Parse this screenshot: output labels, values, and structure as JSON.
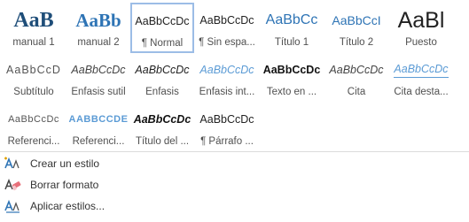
{
  "styles": [
    {
      "preview": "AaB",
      "label": "manual 1"
    },
    {
      "preview": "AaBb",
      "label": "manual 2"
    },
    {
      "preview": "AaBbCcDc",
      "label": "¶ Normal"
    },
    {
      "preview": "AaBbCcDc",
      "label": "¶ Sin espa..."
    },
    {
      "preview": "AaBbCc",
      "label": "Título 1"
    },
    {
      "preview": "AaBbCcI",
      "label": "Título 2"
    },
    {
      "preview": "AaBl",
      "label": "Puesto"
    },
    {
      "preview": "AaBbCcD",
      "label": "Subtítulo"
    },
    {
      "preview": "AaBbCcDc",
      "label": "Énfasis sutil"
    },
    {
      "preview": "AaBbCcDc",
      "label": "Énfasis"
    },
    {
      "preview": "AaBbCcDc",
      "label": "Énfasis int..."
    },
    {
      "preview": "AaBbCcDc",
      "label": "Texto en ..."
    },
    {
      "preview": "AaBbCcDc",
      "label": "Cita"
    },
    {
      "preview": "AaBbCcDc",
      "label": "Cita desta..."
    },
    {
      "preview": "AaBbCcDc",
      "label": "Referenci..."
    },
    {
      "preview": "AABBCCDE",
      "label": "Referenci..."
    },
    {
      "preview": "AaBbCcDc",
      "label": "Título del ..."
    },
    {
      "preview": "AaBbCcDc",
      "label": "¶ Párrafo ..."
    }
  ],
  "commands": [
    {
      "label": "Crear un estilo",
      "icon": "create-style-icon"
    },
    {
      "label": "Borrar formato",
      "icon": "clear-formatting-icon"
    },
    {
      "label": "Aplicar estilos...",
      "icon": "apply-styles-icon"
    }
  ],
  "colors": {
    "heading_blue": "#2e74b5",
    "title_blue": "#1f4e79",
    "selection_border": "#9cbde6"
  }
}
